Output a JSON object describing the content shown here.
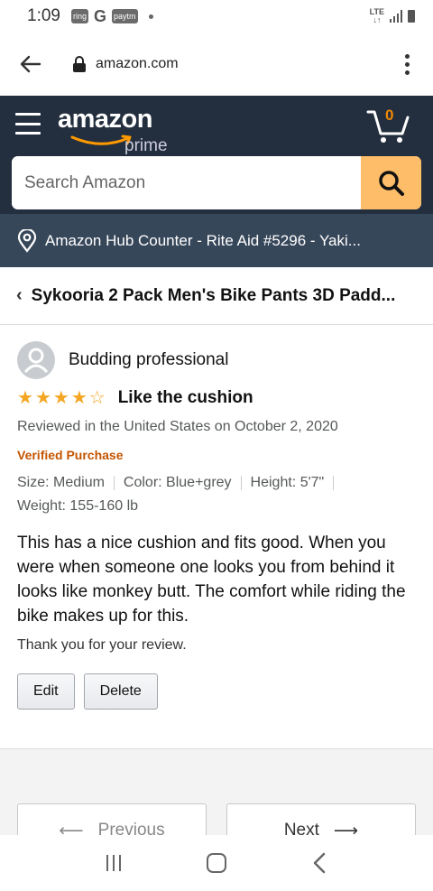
{
  "status_bar": {
    "time": "1:09",
    "badges": [
      "ring",
      "paytm"
    ],
    "g_label": "G",
    "network": "LTE"
  },
  "browser": {
    "url": "amazon.com"
  },
  "header": {
    "logo_text": "amazon",
    "logo_sub": "prime",
    "cart_count": "0",
    "search_placeholder": "Search Amazon"
  },
  "location": {
    "text": "Amazon Hub Counter - Rite Aid #5296 - Yaki..."
  },
  "product": {
    "title": "Sykooria 2 Pack Men's Bike Pants 3D Padd..."
  },
  "review": {
    "reviewer": "Budding professional",
    "rating": 4,
    "max_rating": 5,
    "title": "Like the cushion",
    "date": "Reviewed in the United States on October 2, 2020",
    "verified": "Verified Purchase",
    "attributes": {
      "size": "Size: Medium",
      "color": "Color: Blue+grey",
      "height": "Height: 5'7\"",
      "weight": "Weight: 155-160 lb"
    },
    "body": "This has a nice cushion and fits good. When you were when someone one looks you from behind it looks like monkey butt. The comfort while riding the bike makes up for this.",
    "thanks": "Thank you for your review.",
    "edit_label": "Edit",
    "delete_label": "Delete"
  },
  "pagination": {
    "previous": "Previous",
    "next": "Next"
  },
  "colors": {
    "header_bg": "#232f3e",
    "location_bg": "#37475a",
    "search_button": "#febd69",
    "star": "#f5a623",
    "verified": "#c45500",
    "cart_count": "#f08804"
  }
}
